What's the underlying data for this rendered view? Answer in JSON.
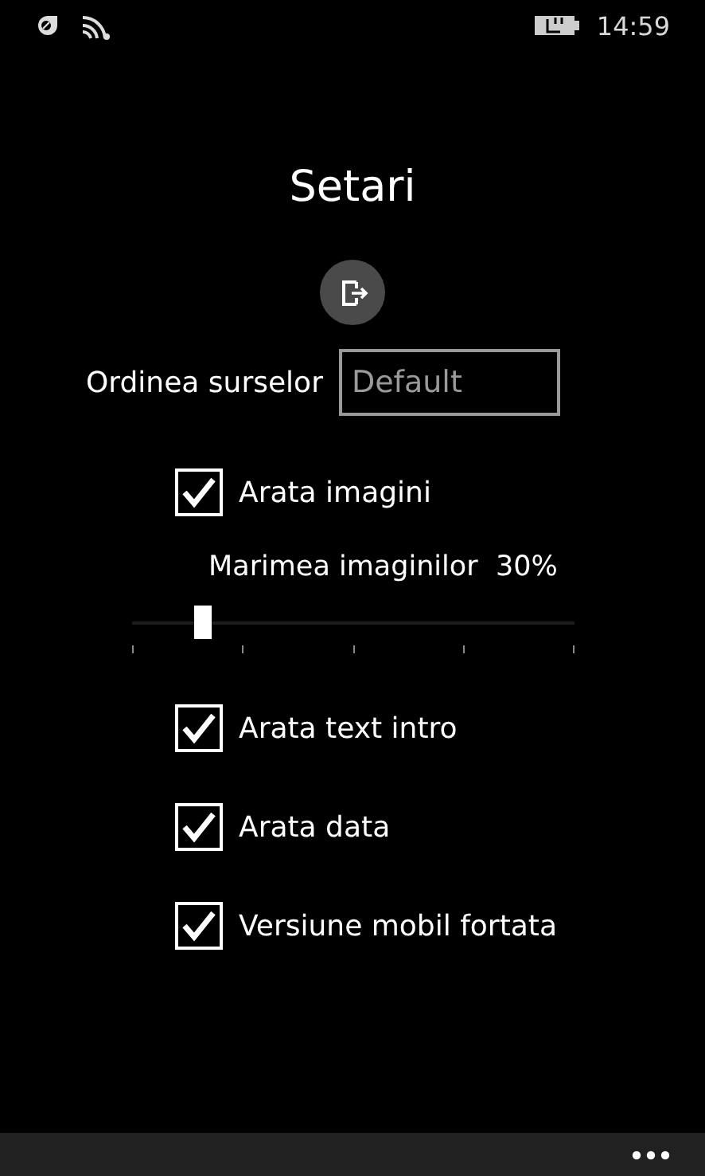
{
  "status_bar": {
    "time": "14:59"
  },
  "title": "Setari",
  "source_order": {
    "label": "Ordinea surselor",
    "placeholder": "Default"
  },
  "options": [
    {
      "kind": "checkbox",
      "label": "Arata imagini",
      "checked": true
    },
    {
      "kind": "slider",
      "label": "Marimea imaginilor",
      "reading": "30%",
      "level": 0.14
    },
    {
      "kind": "checkbox",
      "label": "Arata text intro",
      "checked": true
    },
    {
      "kind": "checkbox",
      "label": "Arata data",
      "checked": true
    },
    {
      "kind": "checkbox",
      "label": "Versiune mobil fortata",
      "checked": true
    }
  ]
}
